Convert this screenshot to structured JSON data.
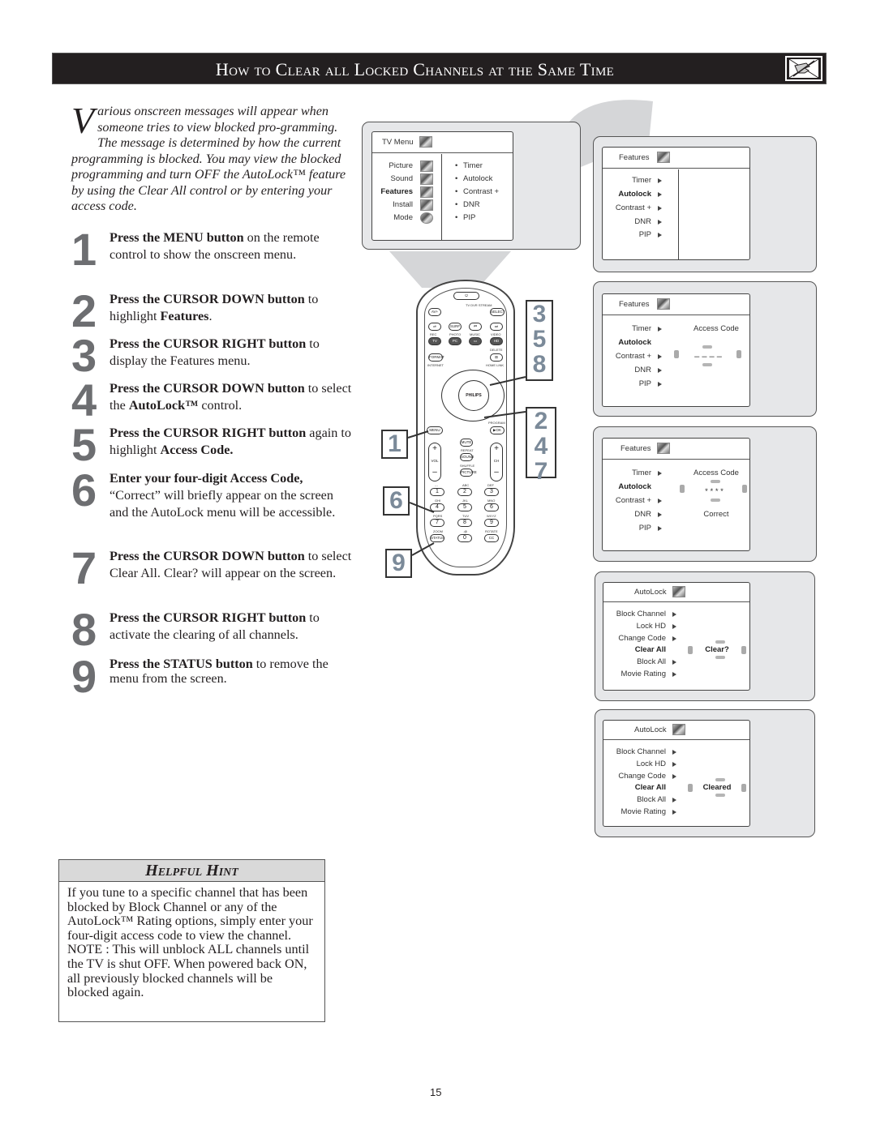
{
  "header": {
    "title": "How to Clear all Locked Channels at the Same Time",
    "icon": "hand-note-icon"
  },
  "intro": {
    "dropcap": "V",
    "text": "arious onscreen messages will appear when someone tries to view blocked pro-gramming. The message is determined by how the current programming is blocked. You may view the blocked programming and turn OFF the AutoLock™ feature by using the Clear All control or by entering your access code."
  },
  "steps": [
    {
      "num": "1",
      "bold": "Press the MENU button",
      "text": " on the remote control to show the onscreen menu."
    },
    {
      "num": "2",
      "bold": "Press the CURSOR DOWN button",
      "text": " to highlight ",
      "bold2": "Features",
      "text2": "."
    },
    {
      "num": "3",
      "bold": "Press the CURSOR RIGHT button",
      "text": " to display the Features menu."
    },
    {
      "num": "4",
      "bold": "Press the CURSOR DOWN button",
      "text": " to select the ",
      "bold2": "AutoLock™",
      "text2": " control."
    },
    {
      "num": "5",
      "bold": "Press the CURSOR RIGHT button",
      "text": " again to highlight ",
      "bold2": "Access Code.",
      "text2": ""
    },
    {
      "num": "6",
      "bold": "Enter your four-digit Access Code,",
      "text": " “Correct” will briefly appear on the screen and the AutoLock menu will be accessible."
    },
    {
      "num": "7",
      "bold": "Press the CURSOR DOWN button",
      "text": " to select Clear All.  Clear? will appear on the screen."
    },
    {
      "num": "8",
      "bold": "Press the CURSOR RIGHT button",
      "text": " to activate the clearing of all channels."
    },
    {
      "num": "9",
      "bold": "Press the STATUS button",
      "text": " to remove the menu from the screen."
    }
  ],
  "hint": {
    "title": "Helpful Hint",
    "body": "If you tune to a specific channel that has been blocked by Block Channel or any of the AutoLock™ Rating options, simply enter your four-digit access code to view the channel.",
    "note": "NOTE : This will unblock ALL channels until the TV is shut OFF. When powered back ON, all previously blocked channels will be blocked again."
  },
  "screens": {
    "tv_menu": {
      "title": "TV Menu",
      "left": [
        "Picture",
        "Sound",
        "Features",
        "Install",
        "Mode"
      ],
      "highlight": "Features",
      "right": [
        "Timer",
        "Autolock",
        "Contrast +",
        "DNR",
        "PIP"
      ]
    },
    "features1": {
      "title": "Features",
      "items": [
        "Timer",
        "Autolock",
        "Contrast +",
        "DNR",
        "PIP"
      ],
      "highlight": "Autolock"
    },
    "features2": {
      "title": "Features",
      "items": [
        "Timer",
        "Autolock",
        "Contrast +",
        "DNR",
        "PIP"
      ],
      "highlight": "Autolock",
      "field_label": "Access Code",
      "field_value": "– – – –"
    },
    "features3": {
      "title": "Features",
      "items": [
        "Timer",
        "Autolock",
        "Contrast +",
        "DNR",
        "PIP"
      ],
      "highlight": "Autolock",
      "field_label": "Access Code",
      "field_value": "* * * *",
      "status": "Correct"
    },
    "autolock1": {
      "title": "AutoLock",
      "items": [
        "Block Channel",
        "Lock HD",
        "Change Code",
        "Clear All",
        "Block All",
        "Movie Rating"
      ],
      "highlight": "Clear All",
      "value": "Clear?"
    },
    "autolock2": {
      "title": "AutoLock",
      "items": [
        "Block Channel",
        "Lock HD",
        "Change Code",
        "Clear All",
        "Block All",
        "Movie Rating"
      ],
      "highlight": "Clear All",
      "value": "Cleared"
    }
  },
  "remote": {
    "brand": "PHILIPS",
    "callouts": {
      "top_right": "3\n5\n8",
      "mid_right": "2\n4\n7",
      "menu": "1",
      "num4": "6",
      "status": "9"
    },
    "labels": {
      "av": "AV+",
      "tv": "TV",
      "dvr": "DVR",
      "stream": "STREAM",
      "select": "SELECT",
      "surf": "SURF",
      "rec": "REC",
      "photo": "PHOTO",
      "music": "MUSIC",
      "video": "VIDEO",
      "tv_btn": "TV",
      "pc": "PC",
      "hd": "HD",
      "format": "FORMAT",
      "internet": "INTERNET",
      "delete": "DELETE",
      "home_link": "HOME LINK",
      "menu": "MENU",
      "program": "PROGRAM",
      "ok": "▶OK",
      "mute": "MUTE",
      "repeat": "REPEAT",
      "sound": "SOUND",
      "shuffle": "SHUFFLE",
      "picture": "PICTURE",
      "vol": "VOL",
      "ch": "CH",
      "status": "STATUS",
      "zoom": "ZOOM",
      "cc": "CC",
      "rotate": "ROTATE",
      "keys": [
        "1",
        "2",
        "3",
        "4",
        "5",
        "6",
        "7",
        "8",
        "9",
        "0"
      ],
      "key_subs": [
        "-.-",
        "ABC",
        "DEF",
        "GHI",
        "JKL",
        "MNO",
        "PQRS",
        "TUV",
        "WXYZ",
        ".@"
      ]
    }
  },
  "footer": {
    "page_number": "15"
  }
}
